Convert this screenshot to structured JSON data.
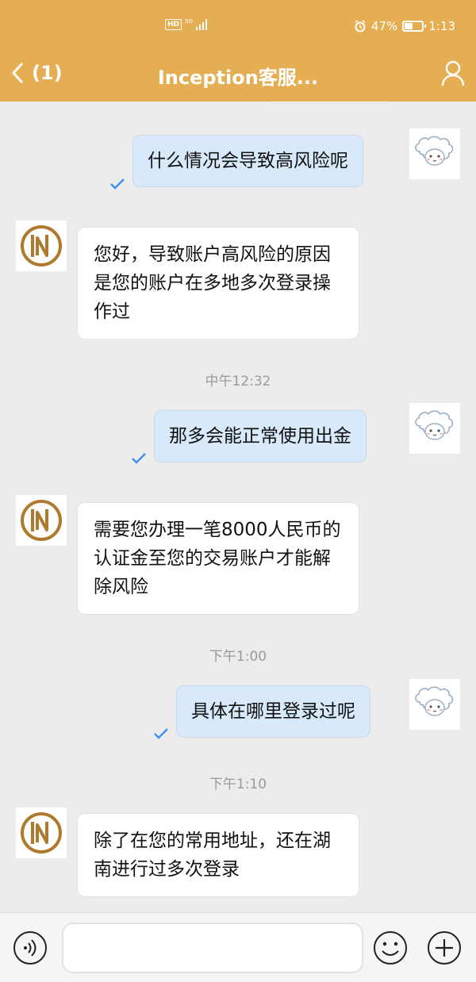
{
  "status_bar": {
    "hd": "HD",
    "network": "5G",
    "battery": "47%",
    "battery_level": 0.47,
    "time": "1:13"
  },
  "nav": {
    "back_count": "(1)",
    "title": "Inception客服..."
  },
  "messages": [
    {
      "side": "out",
      "text": "什么情况会导致高风险呢",
      "avatar": "sheep-avatar-icon",
      "status": "read"
    },
    {
      "side": "in",
      "text": "您好，导致账户高风险的原因是您的账户在多地多次登录操作过",
      "avatar": "inception-logo-icon"
    },
    {
      "time": "中午12:32"
    },
    {
      "side": "out",
      "text": "那多会能正常使用出金",
      "avatar": "sheep-avatar-icon",
      "status": "read"
    },
    {
      "side": "in",
      "text": "需要您办理一笔8000人民币的认证金至您的交易账户才能解除风险",
      "avatar": "inception-logo-icon"
    },
    {
      "time": "下午1:00"
    },
    {
      "side": "out",
      "text": "具体在哪里登录过呢",
      "avatar": "sheep-avatar-icon",
      "status": "read"
    },
    {
      "time": "下午1:10"
    },
    {
      "side": "in",
      "text": "除了在您的常用地址，还在湖南进行过多次登录",
      "avatar": "inception-logo-icon"
    }
  ],
  "input": {
    "value": "",
    "placeholder": ""
  },
  "colors": {
    "header": "#e6ae52",
    "outgoing_bubble": "#d8e9fb",
    "incoming_bubble": "#ffffff",
    "chat_bg": "#ececec",
    "read_check": "#3d8ff0",
    "logo_brown": "#b07a2e"
  }
}
